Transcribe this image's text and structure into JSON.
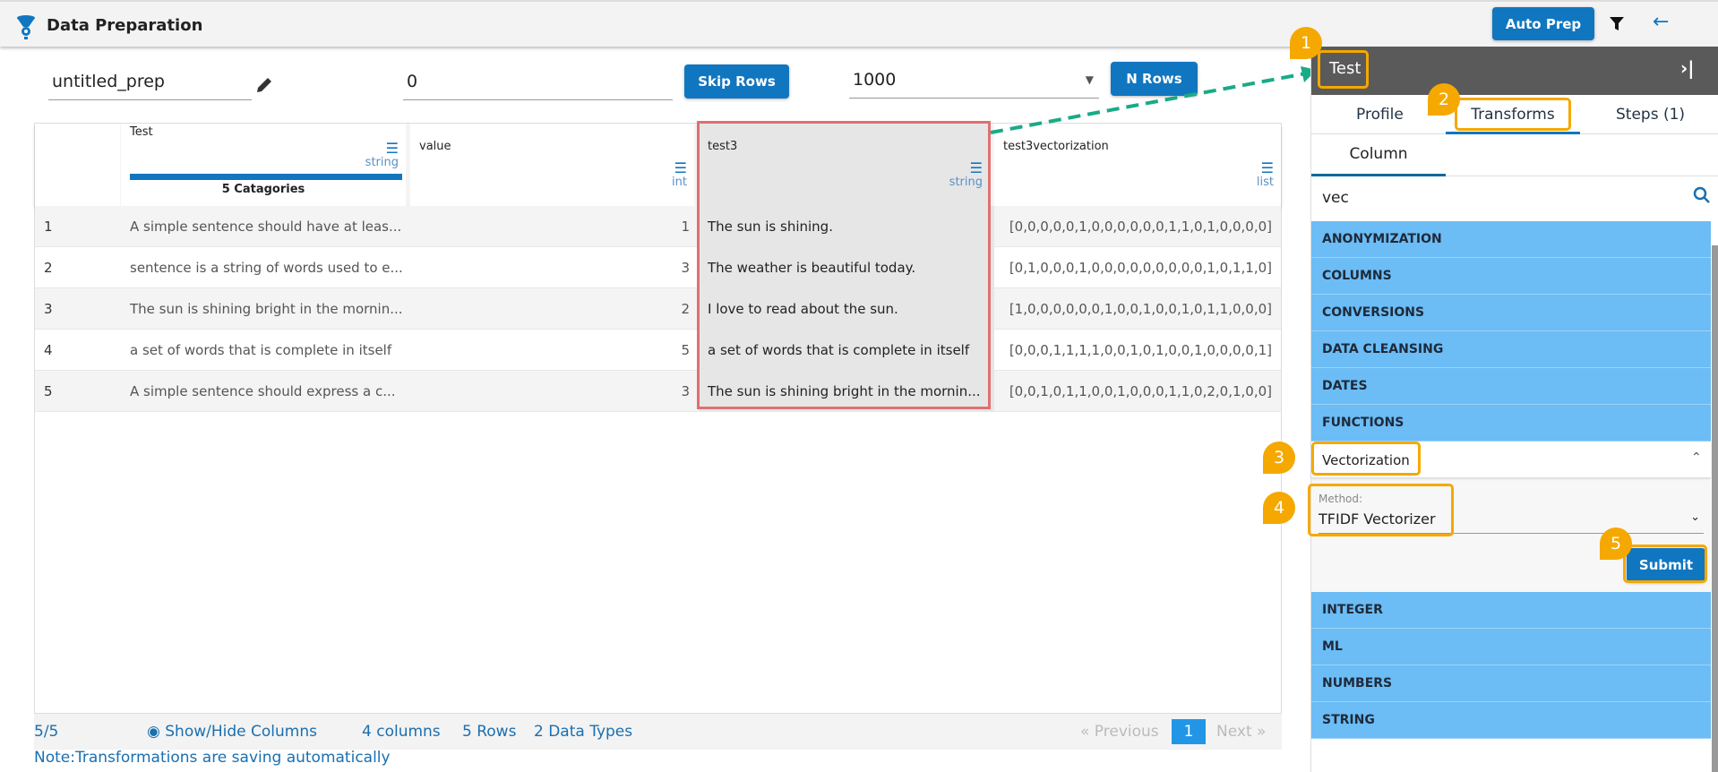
{
  "header": {
    "title": "Data Preparation",
    "auto_prep": "Auto Prep"
  },
  "toolbar": {
    "prep_name": "untitled_prep",
    "skip_value": "0",
    "skip_rows": "Skip Rows",
    "n_value": "1000",
    "n_rows": "N Rows"
  },
  "table": {
    "columns": [
      {
        "name": "Test",
        "type": "string",
        "summary": "5 Catagories"
      },
      {
        "name": "value",
        "type": "int"
      },
      {
        "name": "test3",
        "type": "string"
      },
      {
        "name": "test3vectorization",
        "type": "list"
      }
    ],
    "rows": [
      [
        "1",
        "A simple sentence should have at leas...",
        "1",
        "The sun is shining.",
        "[0,0,0,0,0,1,0,0,0,0,0,0,1,1,0,1,0,0,0,0]"
      ],
      [
        "2",
        "sentence is a string of words used to e...",
        "3",
        "The weather is beautiful today.",
        "[0,1,0,0,0,1,0,0,0,0,0,0,0,0,0,1,0,1,1,0]"
      ],
      [
        "3",
        "The sun is shining bright in the mornin...",
        "2",
        "I love to read about the sun.",
        "[1,0,0,0,0,0,0,1,0,0,1,0,0,1,0,1,1,0,0,0]"
      ],
      [
        "4",
        "a set of words that is complete in itself",
        "5",
        "a set of words that is complete in itself",
        "[0,0,0,1,1,1,1,0,0,1,0,1,0,0,1,0,0,0,0,1]"
      ],
      [
        "5",
        "A simple sentence should express a c...",
        "3",
        "The sun is shining bright in the mornin...",
        "[0,0,1,0,1,1,0,0,1,0,0,0,1,1,0,2,0,1,0,0]"
      ]
    ]
  },
  "footer": {
    "count": "5/5",
    "show_hide": "Show/Hide Columns",
    "columns": "4 columns",
    "rows": "5 Rows",
    "types": "2 Data Types",
    "prev": "« Previous",
    "page": "1",
    "next": "Next »",
    "note": "Note:Transformations are saving automatically"
  },
  "panel": {
    "column_name": "Test",
    "tabs": [
      "Profile",
      "Transforms",
      "Steps (1)"
    ],
    "subtab": "Column",
    "search": "vec",
    "categories_top": [
      "ANONYMIZATION",
      "COLUMNS",
      "CONVERSIONS",
      "DATA CLEANSING",
      "DATES",
      "FUNCTIONS"
    ],
    "expanded": {
      "name": "Vectorization",
      "method_label": "Method:",
      "method_value": "TFIDF Vectorizer",
      "submit": "Submit"
    },
    "categories_bottom": [
      "INTEGER",
      "ML",
      "NUMBERS",
      "STRING"
    ]
  },
  "badges": [
    "1",
    "2",
    "3",
    "4",
    "5"
  ]
}
